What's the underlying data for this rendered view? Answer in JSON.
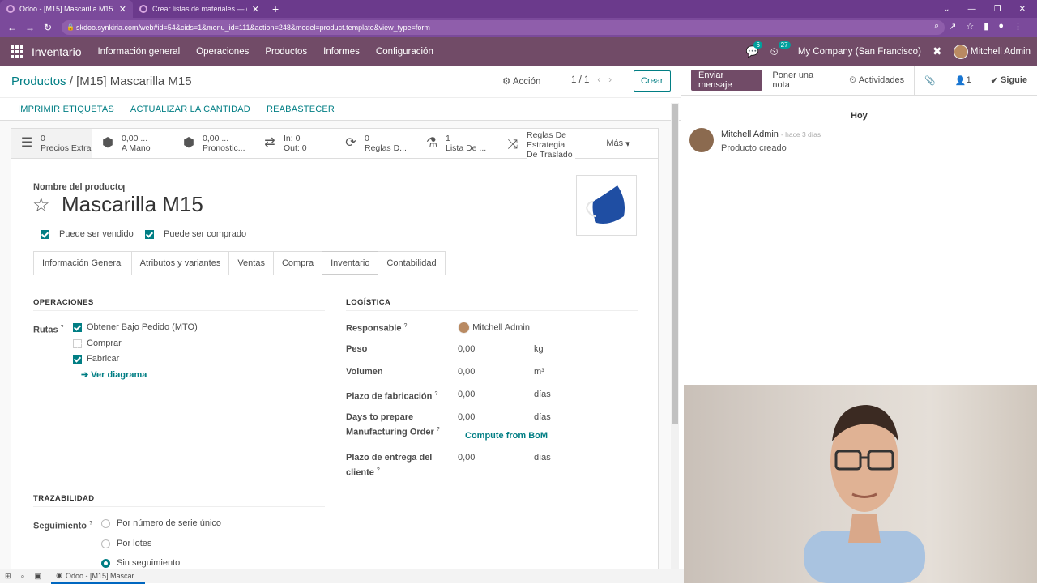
{
  "browser": {
    "tabs": [
      {
        "title": "Odoo - [M15] Mascarilla M15"
      },
      {
        "title": "Crear listas de materiales — doc"
      }
    ],
    "url": "skdoo.synkiria.com/web#id=54&cids=1&menu_id=111&action=248&model=product.template&view_type=form"
  },
  "odoo_nav": {
    "app": "Inventario",
    "menus": [
      "Información general",
      "Operaciones",
      "Productos",
      "Informes",
      "Configuración"
    ],
    "messages_count": "6",
    "activities_count": "27",
    "company": "My Company (San Francisco)",
    "user": "Mitchell Admin"
  },
  "control_panel": {
    "breadcrumb_root": "Productos",
    "breadcrumb_sep": "/",
    "breadcrumb_current": "[M15] Mascarilla M15",
    "action": "Acción",
    "pager": "1 / 1",
    "create": "Crear"
  },
  "buttons": {
    "print": "IMPRIMIR ETIQUETAS",
    "update": "ACTUALIZAR LA CANTIDAD",
    "replenish": "REABASTECER"
  },
  "stats": [
    {
      "v": "0",
      "l": "Precios Extra"
    },
    {
      "v": "0,00 ...",
      "l": "A Mano"
    },
    {
      "v": "0,00 ...",
      "l": "Pronostic..."
    },
    {
      "v": "In:  0",
      "l": "Out:  0"
    },
    {
      "v": "0",
      "l": "Reglas D..."
    },
    {
      "v": "1",
      "l": "Lista De ..."
    },
    {
      "v": "Reglas De",
      "l": "Estrategia De Traslado"
    }
  ],
  "stats_more": "Más",
  "product": {
    "name_label": "Nombre del producto",
    "name": "Mascarilla M15",
    "can_sell": "Puede ser vendido",
    "can_buy": "Puede ser comprado"
  },
  "tabs": [
    "Información General",
    "Atributos y variantes",
    "Ventas",
    "Compra",
    "Inventario",
    "Contabilidad"
  ],
  "operations": {
    "title": "OPERACIONES",
    "routes_label": "Rutas",
    "routes": [
      {
        "label": "Obtener Bajo Pedido (MTO)",
        "checked": true
      },
      {
        "label": "Comprar",
        "checked": false
      },
      {
        "label": "Fabricar",
        "checked": true
      }
    ],
    "diagram": "Ver diagrama"
  },
  "logistics": {
    "title": "LOGÍSTICA",
    "responsible_label": "Responsable",
    "responsible": "Mitchell Admin",
    "weight_label": "Peso",
    "weight": "0,00",
    "weight_unit": "kg",
    "volume_label": "Volumen",
    "volume": "0,00",
    "volume_unit": "m³",
    "mfg_label": "Plazo de fabricación",
    "mfg": "0,00",
    "mfg_unit": "días",
    "prep_label_1": "Days to prepare",
    "prep_label_2": "Manufacturing Order",
    "prep": "0,00",
    "prep_unit": "días",
    "compute": "Compute from BoM",
    "lead_label_1": "Plazo de entrega del",
    "lead_label_2": "cliente",
    "lead": "0,00",
    "lead_unit": "días"
  },
  "tracking": {
    "title": "TRAZABILIDAD",
    "label": "Seguimiento",
    "options": [
      {
        "label": "Por número de serie único",
        "selected": false
      },
      {
        "label": "Por lotes",
        "selected": false
      },
      {
        "label": "Sin seguimiento",
        "selected": true
      }
    ]
  },
  "chatter": {
    "send": "Enviar mensaje",
    "note": "Poner una nota",
    "activities": "Actividades",
    "followers": "1",
    "follow": "Siguie",
    "day": "Hoy",
    "author": "Mitchell Admin",
    "time": "- hace 3 días",
    "body": "Producto creado"
  },
  "taskbar": {
    "item": "Odoo - [M15] Mascar..."
  },
  "colors": {
    "odoo_purple": "#714b67",
    "teal": "#017e84",
    "chrome": "#7b4a9b"
  }
}
